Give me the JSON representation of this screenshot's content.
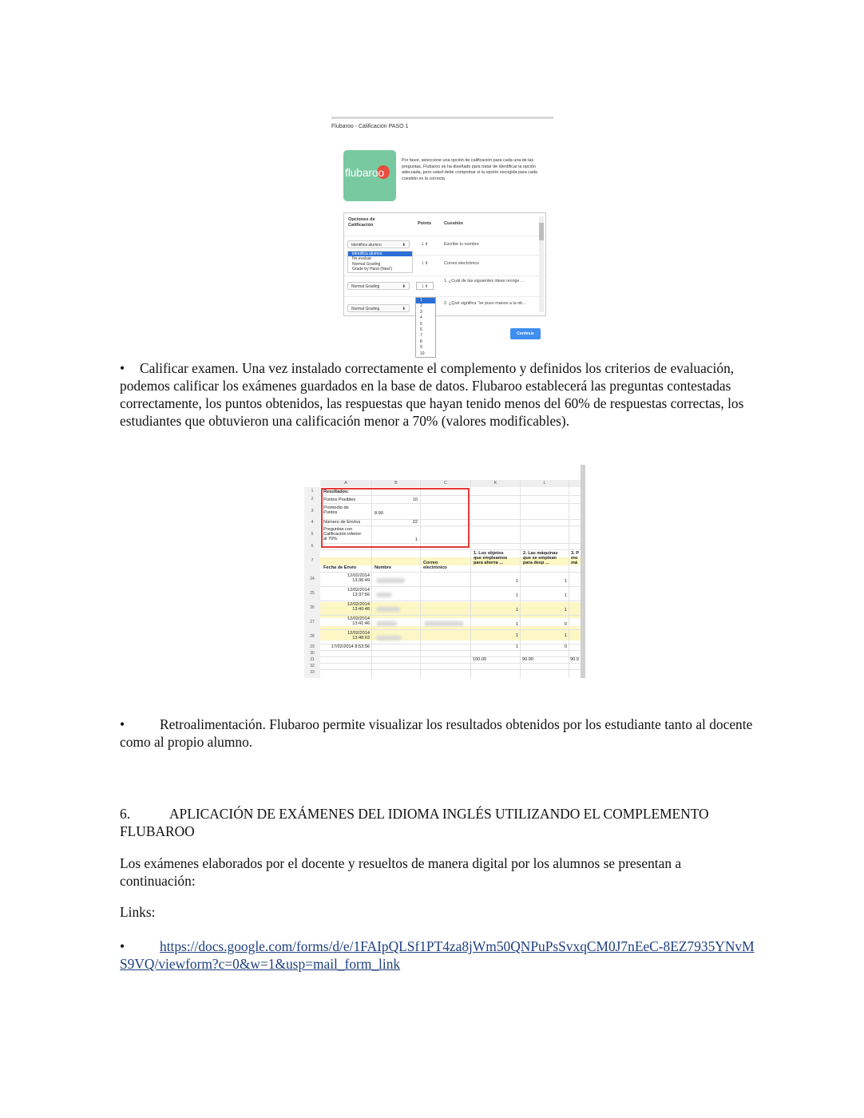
{
  "dialog": {
    "title": "Flubaroo - Calificación PASO 1",
    "logo_text": "flubaroo",
    "intro": "Por favor, seleccione una opción de calificación para cada una de las preguntas. Flubaroo se ha diseñado para tratar de identificar la opción adecuada, pero usted debe comprobar si la opción escogida para cada cuestión es la correcta.",
    "headers": {
      "options": "Opciones de Calificación",
      "points": "Points",
      "question": "Cuestión"
    },
    "rows": [
      {
        "option": "Identifica alumno",
        "points": "1",
        "question": "Escribe tu nombre"
      },
      {
        "option": "",
        "points": "1",
        "question": "Correo electrónico"
      },
      {
        "option": "Normal Grading",
        "points": "1",
        "question": "1. ¿Cuál de las siguientes ideas recoge ..."
      },
      {
        "option": "Normal Grading",
        "points": "",
        "question": "2. ¿Qué significa \"se puso manos a la ob..."
      }
    ],
    "dropdown_options": [
      "identifica alumno",
      "No evaluar",
      "Normal Grading",
      "Grade by Hand (New!)"
    ],
    "number_options": [
      "1",
      "2",
      "3",
      "4",
      "5",
      "6",
      "7",
      "8",
      "9",
      "10"
    ],
    "continue_label": "Continue"
  },
  "paragraphs": {
    "calificar": "Calificar examen. Una vez instalado correctamente el complemento y definidos los criterios de evaluación, podemos calificar los exámenes guardados en la base de datos. Flubaroo establecerá las preguntas contestadas correctamente, los puntos obtenidos, las respuestas que hayan tenido menos del 60% de respuestas correctas, los estudiantes que obtuvieron una calificación menor a 70% (valores modificables).",
    "retro": "Retroalimentación. Flubaroo permite visualizar los resultados obtenidos por los estudiante tanto al docente como al propio alumno.",
    "heading_number": "6.",
    "heading": "APLICACIÓN DE EXÁMENES DEL IDIOMA INGLÉS UTILIZANDO EL COMPLEMENTO FLUBAROO",
    "examenes": "Los exámenes elaborados por el docente y resueltos de manera digital por los alumnos se presentan a continuación:",
    "links_label": "Links:",
    "link": "https://docs.google.com/forms/d/e/1FAIpQLSf1PT4za8jWm50QNPuPsSvxqCM0J7nEeC-8EZ7935YNvMS9VQ/viewform?c=0&w=1&usp=mail_form_link"
  },
  "sheet": {
    "columns": [
      "A",
      "B",
      "C",
      "K",
      "L"
    ],
    "results": {
      "label": "Resultados:",
      "puntos_label": "Puntos Posibles",
      "puntos_value": "10",
      "promedio_label": "Promedio de\nPuntos",
      "promedio_value": "8.90",
      "envios_label": "Número de Envíos",
      "envios_value": "22",
      "preguntas_label": "Preguntas con\nCalificación inferior\nal 70%",
      "preguntas_value": "1"
    },
    "headers": {
      "fecha": "Fecha de Envío",
      "nombre": "Nombre",
      "correo": "Correo\nelectrónico",
      "q1": "1. Los objetos\nque empleamos\npara ahorra ...",
      "q2": "2. Las máquinas\nque se emplean\npara desp ...",
      "q3": "3. P\nmo\nmá"
    },
    "row_numbers": [
      "1",
      "2",
      "3",
      "4",
      "5",
      "6",
      "7",
      "24",
      "25",
      "26",
      "27",
      "28",
      "29",
      "30",
      "31",
      "32",
      "33"
    ],
    "rows": [
      {
        "date": "12/02/2014\n13:36:49",
        "k": "1",
        "l": "1"
      },
      {
        "date": "12/02/2014\n13:37:56",
        "k": "1",
        "l": "1"
      },
      {
        "date": "12/02/2014\n13:40:48",
        "k": "1",
        "l": "1"
      },
      {
        "date": "12/02/2014\n13:41:46",
        "k": "1",
        "l": "0"
      },
      {
        "date": "12/02/2014\n13:48:03",
        "k": "1",
        "l": "1"
      },
      {
        "date": "17/02/2014 8:53:56",
        "k": "1",
        "l": "0"
      }
    ],
    "totals": {
      "k": "100.00",
      "l": "90.90",
      "m": "90.9"
    }
  }
}
